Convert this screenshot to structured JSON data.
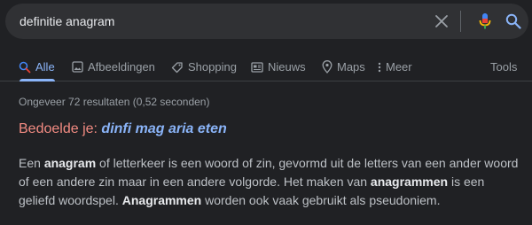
{
  "search": {
    "query": "definitie anagram"
  },
  "icons": {
    "clear": "close-icon",
    "mic": "microphone-icon",
    "search": "search-icon"
  },
  "tabs": [
    {
      "label": "Alle",
      "icon": "search-icon",
      "active": true
    },
    {
      "label": "Afbeeldingen",
      "icon": "image-icon",
      "active": false
    },
    {
      "label": "Shopping",
      "icon": "tag-icon",
      "active": false
    },
    {
      "label": "Nieuws",
      "icon": "newspaper-icon",
      "active": false
    },
    {
      "label": "Maps",
      "icon": "map-pin-icon",
      "active": false
    },
    {
      "label": "Meer",
      "icon": "more-vert-icon",
      "active": false
    }
  ],
  "tools_label": "Tools",
  "result_stats": "Ongeveer 72 resultaten (0,52 seconden)",
  "did_you_mean": {
    "label": "Bedoelde je:",
    "suggestion": "dinfi mag aria eten"
  },
  "snippet": {
    "s1": "Een ",
    "b1": "anagram",
    "s2": " of letterkeer is een woord of zin, gevormd uit de letters van een ander woord of een andere zin maar in een andere volgorde. Het maken van ",
    "b2": "anagrammen",
    "s3": " is een geliefd woordspel. ",
    "b3": "Anagrammen",
    "s4": " worden ook vaak gebruikt als pseudoniem."
  },
  "colors": {
    "background": "#202124",
    "searchbar": "#303134",
    "link": "#8ab4f8",
    "correction_label": "#f28b82",
    "muted": "#9aa0a6",
    "text": "#bdc1c6"
  }
}
